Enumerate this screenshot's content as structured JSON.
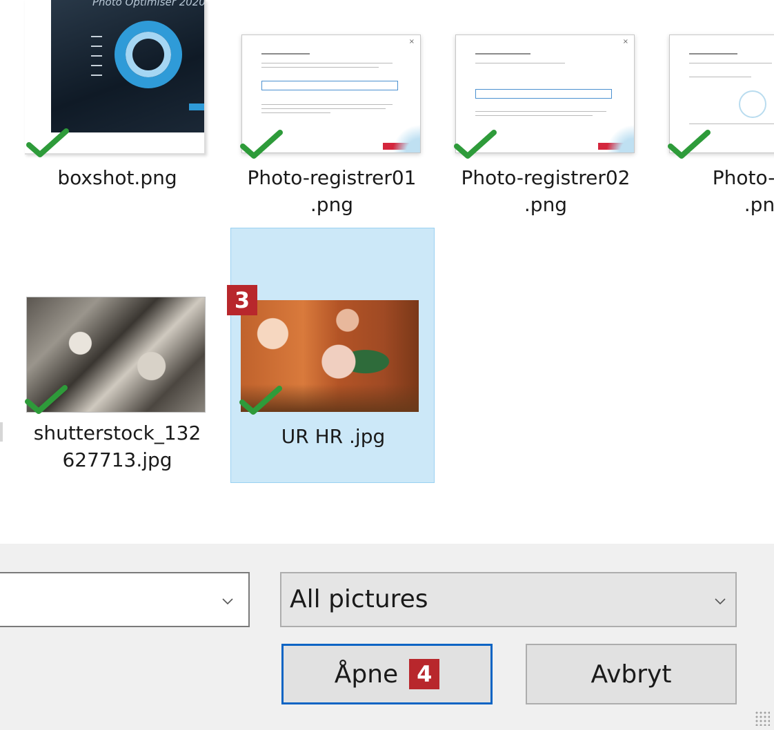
{
  "files": [
    {
      "name": "boxshot.png",
      "line2": "",
      "checked": true,
      "selected": false,
      "brand_text": "Photo Optimiser 2020"
    },
    {
      "name": "Photo-registrer01",
      "line2": ".png",
      "checked": true,
      "selected": false
    },
    {
      "name": "Photo-registrer02",
      "line2": ".png",
      "checked": true,
      "selected": false
    },
    {
      "name": "Photo-reg",
      "line2": ".pn",
      "checked": true,
      "selected": false
    },
    {
      "name": "shutterstock_132",
      "line2": "627713.jpg",
      "checked": true,
      "selected": false
    },
    {
      "name": "UR HR .jpg",
      "line2": "",
      "checked": true,
      "selected": true
    }
  ],
  "step_badges": {
    "file": "3",
    "open": "4"
  },
  "footer": {
    "filename_value": "",
    "filetype_value": "All pictures",
    "open_label": "Åpne",
    "cancel_label": "Avbryt"
  },
  "colors": {
    "check": "#2e9b3a",
    "badge": "#b8272c",
    "selection": "#cce8f8",
    "primary_border": "#0a64c4"
  }
}
